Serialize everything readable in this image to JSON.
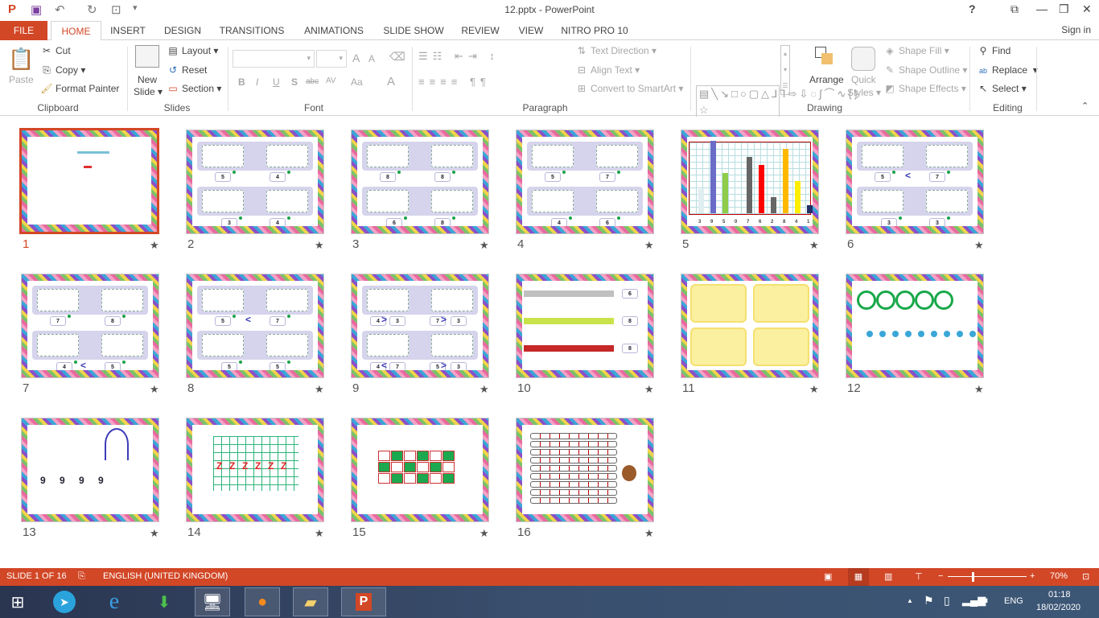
{
  "window": {
    "title": "12.pptx - PowerPoint",
    "help": "?",
    "ribbon_display": "⧉",
    "minimize": "—",
    "restore": "❐",
    "close": "✕"
  },
  "quick_access": {
    "app_icon": "powerpoint-icon",
    "save": "save-icon",
    "undo": "undo-icon",
    "redo": "redo-icon",
    "present": "present-from-start-icon",
    "customize": "▾"
  },
  "tabs": [
    "FILE",
    "HOME",
    "INSERT",
    "DESIGN",
    "TRANSITIONS",
    "ANIMATIONS",
    "SLIDE SHOW",
    "REVIEW",
    "VIEW",
    "NITRO PRO 10"
  ],
  "active_tab": "HOME",
  "sign_in": "Sign in",
  "ribbon": {
    "clipboard": {
      "label": "Clipboard",
      "paste": "Paste",
      "cut": "Cut",
      "copy": "Copy",
      "format_painter": "Format Painter"
    },
    "slides": {
      "label": "Slides",
      "new_slide": "New",
      "new_slide2": "Slide",
      "layout": "Layout",
      "reset": "Reset",
      "section": "Section"
    },
    "font": {
      "label": "Font",
      "font_name": "",
      "font_size": "",
      "grow": "A",
      "shrink": "A",
      "bold": "B",
      "italic": "I",
      "underline": "U",
      "shadow": "S",
      "strike": "abc",
      "spacing": "AV",
      "case": "Aa",
      "color": "A"
    },
    "paragraph": {
      "label": "Paragraph",
      "text_direction": "Text Direction",
      "align_text": "Align Text",
      "smartart": "Convert to SmartArt"
    },
    "drawing": {
      "label": "Drawing",
      "arrange": "Arrange",
      "quick_styles": "Quick",
      "quick_styles2": "Styles",
      "shape_fill": "Shape Fill",
      "shape_outline": "Shape Outline",
      "shape_effects": "Shape Effects",
      "shapes_gallery": "▤╲↘□○▢△⅃⅂⇨⇩◌∫⌒∿{}☆"
    },
    "editing": {
      "label": "Editing",
      "find": "Find",
      "replace": "Replace",
      "select": "Select"
    }
  },
  "slides": [
    {
      "n": "1",
      "kind": "title",
      "labels": []
    },
    {
      "n": "2",
      "kind": "quad",
      "labels": [
        "5",
        "4",
        "3",
        "4"
      ],
      "ops": [
        "",
        ""
      ]
    },
    {
      "n": "3",
      "kind": "quad",
      "labels": [
        "8",
        "8",
        "6",
        "8"
      ],
      "ops": [
        "",
        ""
      ]
    },
    {
      "n": "4",
      "kind": "quad",
      "labels": [
        "5",
        "7",
        "4",
        "6"
      ],
      "ops": [
        "",
        ""
      ]
    },
    {
      "n": "5",
      "kind": "chart",
      "values": [
        3,
        9,
        5,
        0,
        7,
        6,
        2,
        8,
        4,
        1
      ],
      "colors": [
        "#e0eef0",
        "#6b6bc8",
        "#8fcc4a",
        "#ccc",
        "#666",
        "#f00",
        "#666",
        "#ffb800",
        "#ffee00",
        "#223066"
      ]
    },
    {
      "n": "6",
      "kind": "quad",
      "labels": [
        "5",
        "7",
        "3",
        "3"
      ],
      "ops": [
        "<",
        ""
      ]
    },
    {
      "n": "7",
      "kind": "quad",
      "labels": [
        "7",
        "8",
        "4",
        "5"
      ],
      "ops": [
        "",
        "<"
      ]
    },
    {
      "n": "8",
      "kind": "quad",
      "labels": [
        "5",
        "7",
        "5",
        "5"
      ],
      "ops": [
        "<",
        ""
      ]
    },
    {
      "n": "9",
      "kind": "quad4",
      "labels": [
        "4",
        "3",
        "7",
        "3",
        "4",
        "7",
        "5",
        "3"
      ],
      "ops": [
        ">",
        ">",
        "<",
        ">"
      ]
    },
    {
      "n": "10",
      "kind": "rows",
      "labels": [
        "6",
        "8",
        "8"
      ]
    },
    {
      "n": "11",
      "kind": "pictures",
      "labels": []
    },
    {
      "n": "12",
      "kind": "caterpillar",
      "labels": []
    },
    {
      "n": "13",
      "kind": "digits",
      "labels": [
        "9",
        "9",
        "9",
        "9"
      ]
    },
    {
      "n": "14",
      "kind": "zgrid",
      "labels": [
        "Z",
        "Z",
        "Z",
        "Z",
        "Z",
        "Z"
      ]
    },
    {
      "n": "15",
      "kind": "grid",
      "labels": []
    },
    {
      "n": "16",
      "kind": "table",
      "labels": []
    }
  ],
  "slide_star": "★",
  "status": {
    "slide_info": "SLIDE 1 OF 16",
    "language": "ENGLISH (UNITED KINGDOM)",
    "zoom": "70%"
  },
  "taskbar": {
    "apps": [
      "start-icon",
      "telegram-icon",
      "internet-explorer-icon",
      "download-manager-icon",
      "remote-desktop-icon",
      "firefox-icon",
      "file-explorer-icon",
      "powerpoint-icon"
    ],
    "lang": "ENG",
    "time": "01:18",
    "date": "18/02/2020"
  }
}
